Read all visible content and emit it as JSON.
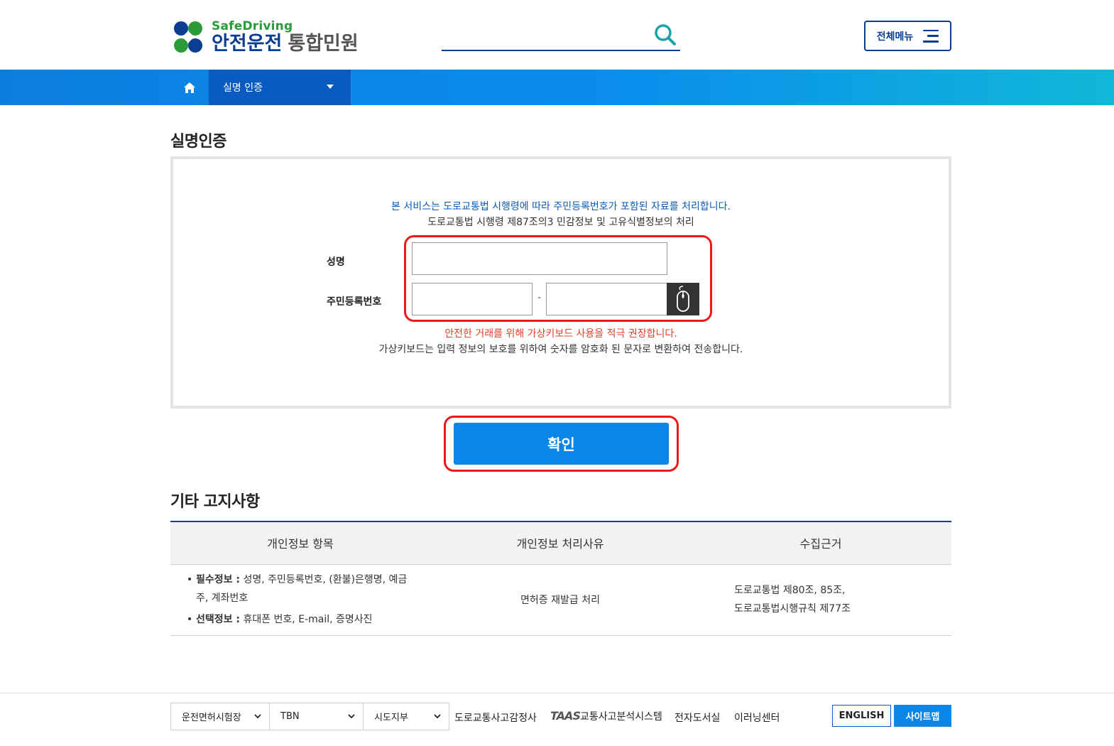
{
  "header": {
    "logo_en": "SafeDriving",
    "logo_kr": "안전운전",
    "logo_sub": "통합민원",
    "search_placeholder": "",
    "all_menu_label": "전체메뉴"
  },
  "nav": {
    "current_menu": "실명 인증"
  },
  "verify": {
    "title": "실명인증",
    "notice_blue": "본 서비스는 도로교통법 시행령에 따라 주민등록번호가 포함된 자료를 처리합니다.",
    "notice_dark": "도로교통법 시행령 제87조의3 민감정보 및 고유식별정보의 처리",
    "name_label": "성명",
    "rrn_label": "주민등록번호",
    "name_value": "",
    "rrn_front_value": "",
    "rrn_back_value": "",
    "dash": "-",
    "warn_red": "안전한 거래를 위해 가상키보드 사용을 적극 권장합니다.",
    "warn_dark": "가상키보드는 입력 정보의 보호를 위하여 숫자를 암호화 된 문자로 변환하여 전송합니다.",
    "confirm_label": "확인"
  },
  "notice": {
    "title": "기타 고지사항",
    "headers": [
      "개인정보 항목",
      "개인정보 처리사유",
      "수집근거"
    ],
    "required_label": "필수정보 :",
    "required_text_1": " 성명, 주민등록번호, (환불)은행명, 예금",
    "required_text_2": "주, 계좌번호",
    "optional_label": "선택정보 :",
    "optional_text": " 휴대폰 번호, E-mail, 증명사진",
    "reason": "면허증 재발급 처리",
    "basis_1": "도로교통법 제80조, 85조,",
    "basis_2": "도로교통법시행규칙 제77조"
  },
  "footer": {
    "selects": [
      "운전면허시험장",
      "TBN",
      "시도지부"
    ],
    "links": [
      "도로교통사고감정사",
      "교통사고분석시스템",
      "전자도서실",
      "이러닝센터"
    ],
    "taas": "TAAS",
    "english": "ENGLISH",
    "sitemap": "사이트맵"
  },
  "colors": {
    "brand_navy": "#0b3d91",
    "brand_blue": "#0a86e8",
    "brand_green": "#2a9a3a",
    "highlight_red": "#ee1a1a",
    "warn_red": "#e53e2a"
  },
  "icons": [
    "clover-logo-icon",
    "search-icon",
    "hamburger-icon",
    "home-icon",
    "caret-down-icon",
    "mouse-icon",
    "chevron-down-icon"
  ]
}
